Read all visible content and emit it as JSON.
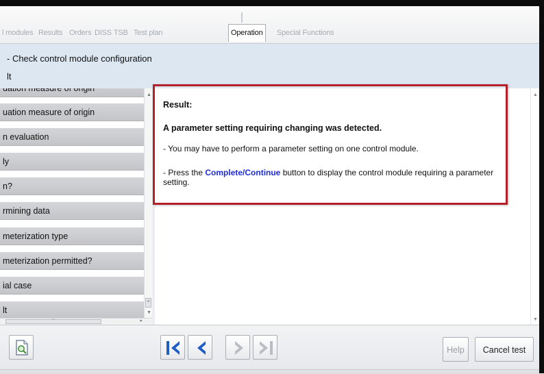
{
  "tabs": [
    {
      "label": "l modules",
      "active": false
    },
    {
      "label": "Results",
      "active": false
    },
    {
      "label": "Orders",
      "active": false
    },
    {
      "label": "DISS",
      "active": false
    },
    {
      "label": "TSB",
      "active": false
    },
    {
      "label": "Test plan",
      "active": false
    },
    {
      "label": "Operation",
      "active": true
    },
    {
      "label": "Special Functions",
      "active": false
    }
  ],
  "header": {
    "title": "- Check control module configuration",
    "subtitle": "lt"
  },
  "left_list": {
    "items": [
      "uation measure of origin",
      "uation measure of origin",
      "n evaluation",
      "ly",
      "n?",
      "rmining data",
      "meterization type",
      "meterization permitted?",
      "ial case",
      "lt"
    ]
  },
  "result": {
    "heading": "Result:",
    "main": "A parameter setting requiring changing was detected.",
    "line1": "- You may have to perform a parameter setting on one control module.",
    "line2_prefix": "- Press the ",
    "line2_link": "Complete/Continue",
    "line2_suffix": " button to display the control module requiring a parameter setting."
  },
  "toolbar": {
    "help_label": "Help",
    "cancel_label": "Cancel test"
  },
  "colors": {
    "highlight_border": "#b3202a",
    "link_blue": "#1d2bd8",
    "nav_blue": "#1f5fc4",
    "nav_disabled": "#b9bcc4"
  }
}
